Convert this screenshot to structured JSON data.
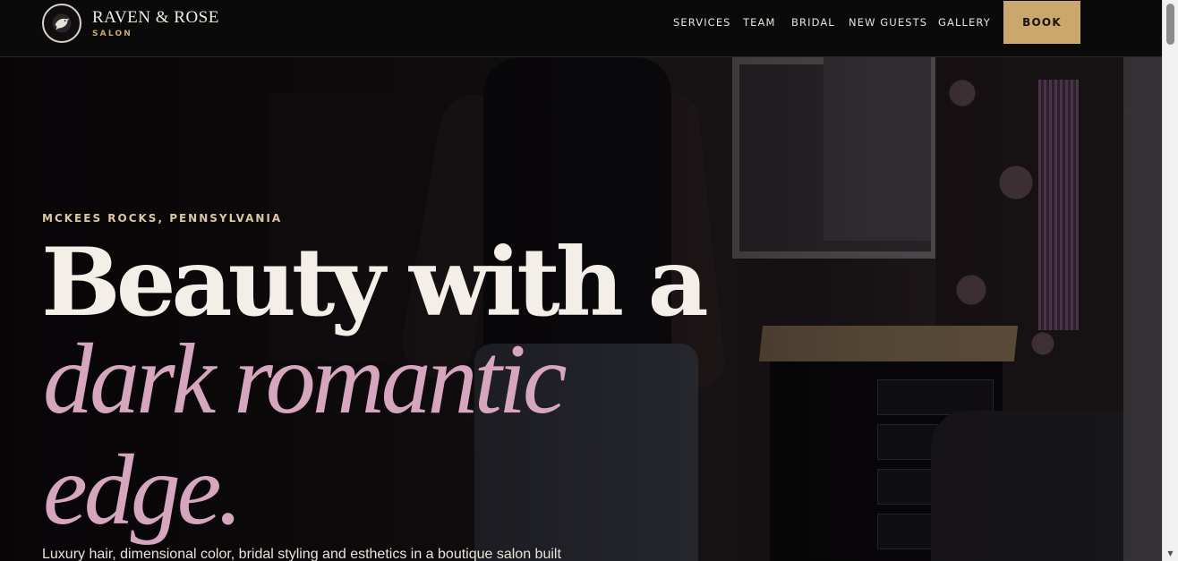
{
  "header": {
    "brand_name": "RAVEN & ROSE",
    "brand_sub": "SALON",
    "logo_icon": "raven-rose-emblem-icon",
    "nav": [
      {
        "label": "SERVICES"
      },
      {
        "label": "TEAM"
      },
      {
        "label": "BRIDAL"
      },
      {
        "label": "NEW GUESTS"
      },
      {
        "label": "GALLERY"
      }
    ],
    "book_label": "BOOK"
  },
  "hero": {
    "eyebrow": "MCKEES ROCKS, PENNSYLVANIA",
    "headline_line1": "Beauty with a",
    "headline_line2": "dark romantic",
    "headline_line3": "edge.",
    "subcopy": "Luxury hair, dimensional color, bridal styling and esthetics in a boutique salon built"
  },
  "colors": {
    "header_bg": "#0b0a0b",
    "accent_gold": "#c9a76d",
    "headline_light": "#f3eee7",
    "headline_rose": "#d6a6be",
    "eyebrow": "#dcc79e"
  },
  "scrollbar": {
    "up_icon": "scroll-up-arrow-icon",
    "down_icon": "scroll-down-arrow-icon"
  }
}
